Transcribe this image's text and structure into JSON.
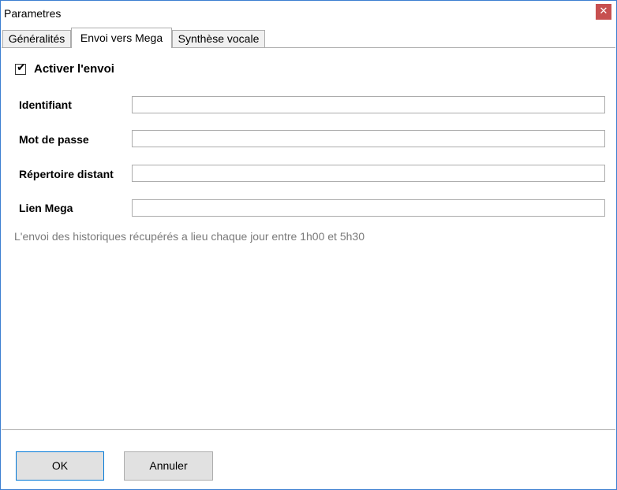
{
  "window": {
    "title": "Parametres",
    "close_symbol": "✕"
  },
  "tabs": [
    {
      "label": "Généralités",
      "active": false
    },
    {
      "label": "Envoi vers Mega",
      "active": true
    },
    {
      "label": "Synthèse vocale",
      "active": false
    }
  ],
  "panel": {
    "enable_checkbox": {
      "label": "Activer l'envoi",
      "checked": true,
      "check_symbol": "✔"
    },
    "fields": [
      {
        "label": "Identifiant",
        "value": ""
      },
      {
        "label": "Mot de passe",
        "value": ""
      },
      {
        "label": "Répertoire distant",
        "value": ""
      },
      {
        "label": "Lien Mega",
        "value": ""
      }
    ],
    "note": "L'envoi des historiques récupérés a lieu chaque jour entre 1h00 et 5h30"
  },
  "buttons": {
    "ok_label": "OK",
    "cancel_label": "Annuler"
  },
  "colors": {
    "window_border": "#3c7fd1",
    "close_button": "#c75050",
    "default_button_border": "#0078d7",
    "note_text": "#7a7a7a"
  }
}
